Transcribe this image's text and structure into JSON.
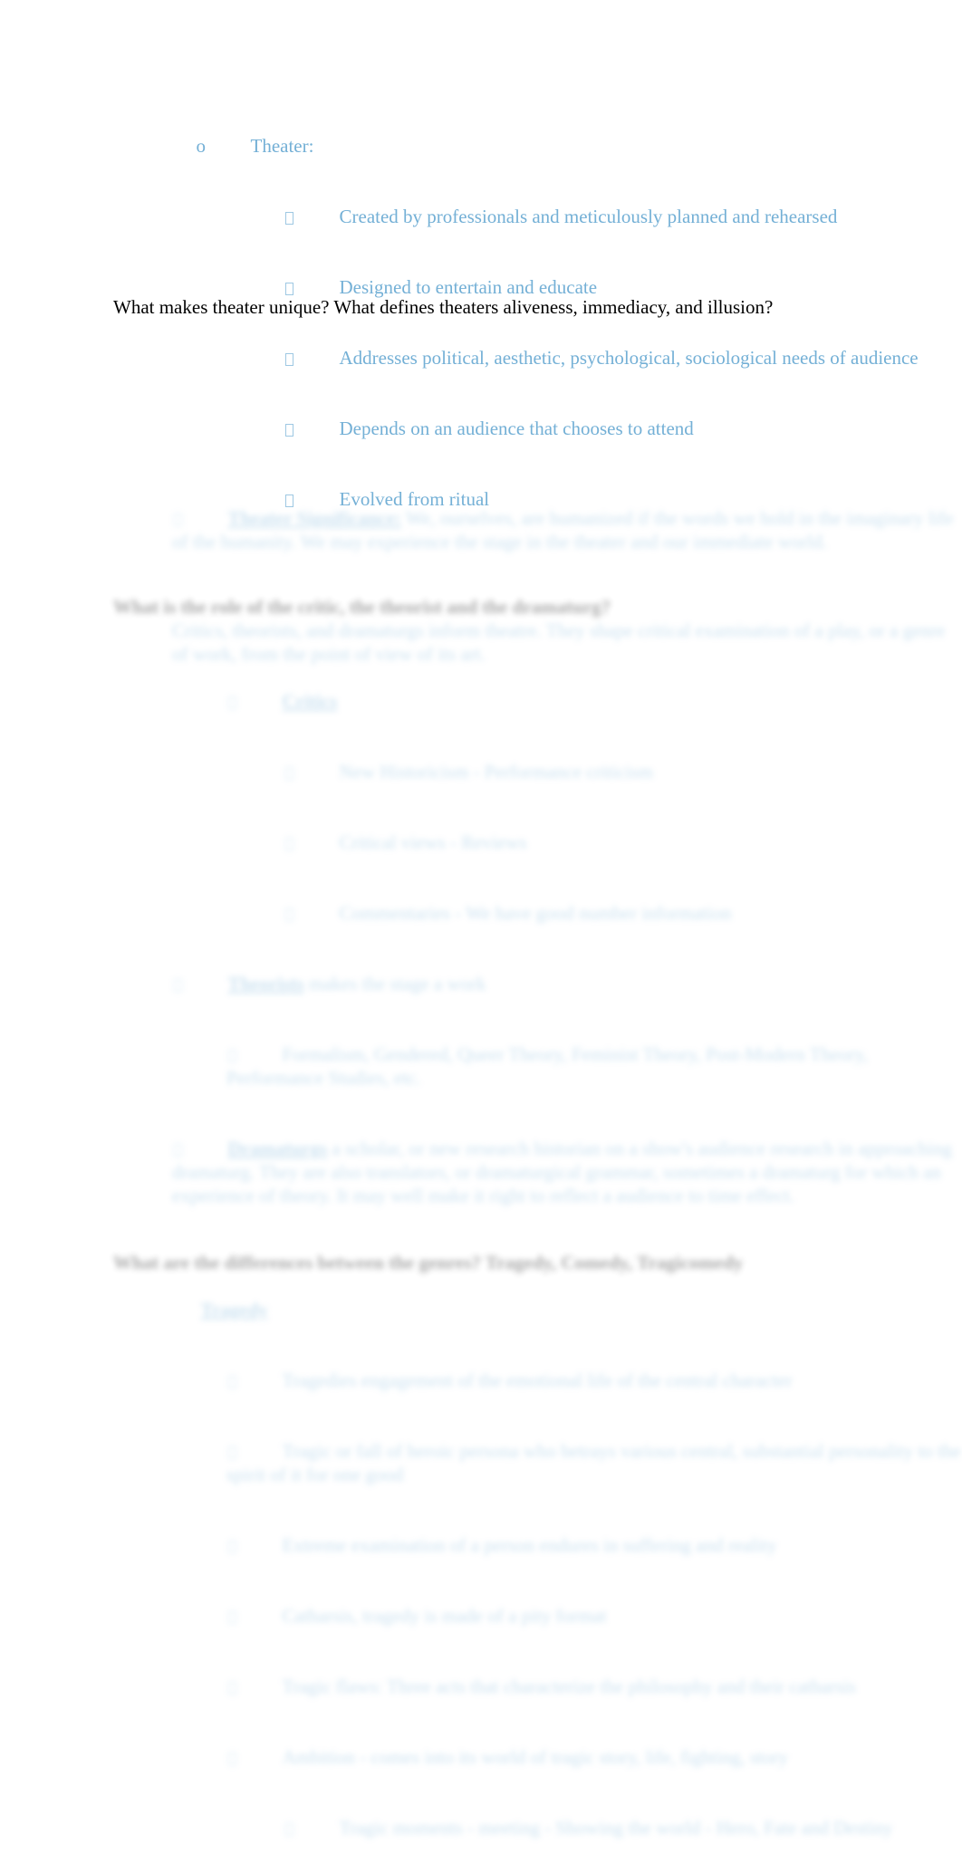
{
  "document": {
    "background_color": "#ffffff",
    "body_text_color": "#74b0d6",
    "heading_text_color": "#1a1a1a",
    "question_text_color": "#000000"
  },
  "top_outline": {
    "parent": {
      "marker": "o",
      "label": "Theater:"
    },
    "children": [
      {
        "marker": "box-glyph",
        "text": "Created by professionals and meticulously planned and rehearsed"
      },
      {
        "marker": "box-glyph",
        "text": "Designed to entertain and educate"
      },
      {
        "marker": "box-glyph",
        "text": "Addresses political, aesthetic, psychological, sociological needs of audience"
      },
      {
        "marker": "box-glyph",
        "text": "Depends on an audience that chooses to attend"
      },
      {
        "marker": "box-glyph",
        "text": "Evolved from ritual"
      }
    ]
  },
  "question_line": {
    "text": "What makes theater unique? What defines theaters aliveness, immediacy, and illusion?"
  },
  "faded_section": {
    "note_blurred": true,
    "block_a": {
      "marker": "box-glyph",
      "term": "Theater Significance:",
      "text": " We, ourselves, are humanized if the words we hold in the imaginary life of the humanity. We may experience the stage in the theater and our immediate world."
    },
    "heading_1": {
      "text": "What is the role of the critic, the theorist and the dramaturg?"
    },
    "heading_1_paragraph": {
      "text": "Critics, theorists, and dramaturgs inform theatre. They shape critical examination of a play, or a genre of work, from the point of view of its art."
    },
    "sub_blocks": [
      {
        "marker": "box-glyph",
        "term": "Critics",
        "children": [
          {
            "marker": "box-glyph",
            "text": "New Historicism - Performance criticism"
          },
          {
            "marker": "box-glyph",
            "text": "Critical views - Reviews"
          },
          {
            "marker": "box-glyph",
            "text": "Commentaries - We have good number information"
          }
        ]
      },
      {
        "marker": "box-glyph",
        "term": "Theorists",
        "text": " makes the stage a work",
        "children": [
          {
            "marker": "box-glyph",
            "text": "Formalism, Gendered, Queer Theory, Feminist Theory, Post-Modern Theory, Performance Studies, etc."
          }
        ]
      },
      {
        "marker": "box-glyph",
        "term": "Dramaturgs",
        "text": " a scholar, or new research historian on a show's audience research in approaching dramaturg. They are also translators, or dramaturgical grammar, sometimes a dramaturg for which an experience of theory. It may well make it right to reflect a audience to time effect."
      }
    ],
    "heading_2": {
      "text": "What are the differences between the genres? Tragedy, Comedy, Tragicomedy"
    },
    "genre_block": {
      "term": "Tragedy",
      "children": [
        {
          "marker": "box-glyph",
          "text": "Tragedies engagement of the emotional life of the central character"
        },
        {
          "marker": "box-glyph",
          "text": "Tragic or fall of heroic persona who betrays various central, substantial personality to the spirit of it for one good"
        },
        {
          "marker": "box-glyph",
          "text": "Extreme examination of a person endures in suffering and reality"
        },
        {
          "marker": "box-glyph",
          "text": "Catharsis, tragedy is made of a pity format"
        },
        {
          "marker": "box-glyph",
          "text": "Tragic flaws: Three acts that characterize the philosophy and their catharsis"
        },
        {
          "marker": "box-glyph",
          "text": "Ambition - comes into its world of tragic story, life, fighting, story",
          "children": [
            {
              "marker": "box-glyph",
              "text": "Tragic moments - meeting - Showing the world - Hero, Fate and Destiny"
            }
          ]
        }
      ]
    }
  }
}
